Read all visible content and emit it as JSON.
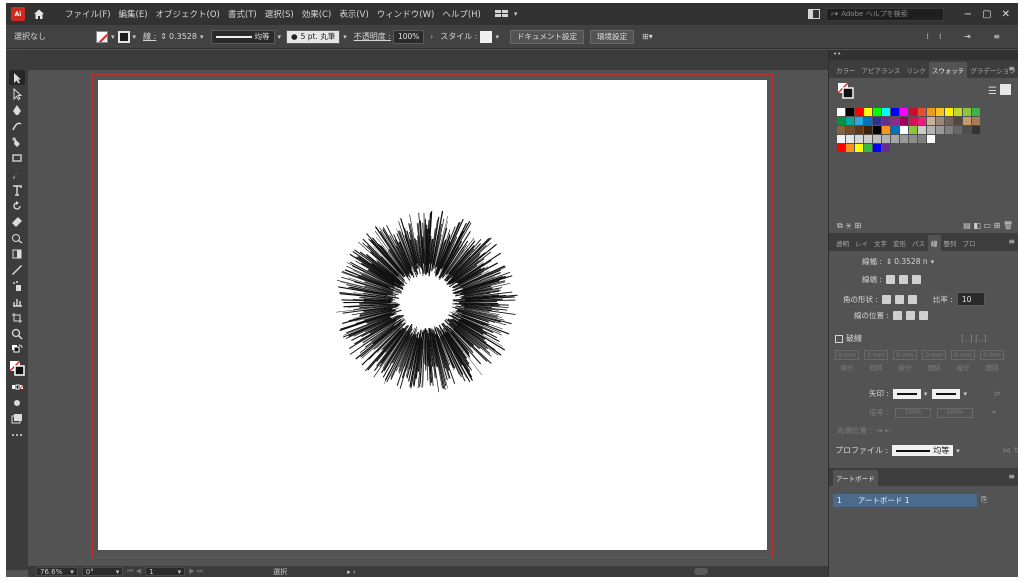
{
  "app": {
    "logo_text": "Ai",
    "menu": [
      "ファイル(F)",
      "編集(E)",
      "オブジェクト(O)",
      "書式(T)",
      "選択(S)",
      "効果(C)",
      "表示(V)",
      "ウィンドウ(W)",
      "ヘルプ(H)"
    ],
    "search_placeholder": "Adobe ヘルプを検索",
    "window_controls": [
      "−",
      "▢",
      "✕"
    ]
  },
  "controlbar": {
    "selection_status": "選択なし",
    "stroke_label": "線 :",
    "stroke_weight": "0.3528",
    "profile_label": "均等",
    "brush_label": "5 pt. 丸筆",
    "opacity_label": "不透明度 :",
    "opacity_value": "100%",
    "style_label": "スタイル :",
    "document_setup": "ドキュメント設定",
    "preferences": "環境設定"
  },
  "statusbar": {
    "zoom": "76.6%",
    "rotation": "0°",
    "artboard_number": "1",
    "tool_status": "選択"
  },
  "swatches_panel": {
    "tabs": [
      "カラー",
      "アピアランス",
      "リンク",
      "スウォッチ",
      "グラデーション"
    ],
    "active_tab": "スウォッチ",
    "rows": [
      [
        "#ffffff",
        "#000000",
        "#ff0000",
        "#ffff00",
        "#00ff00",
        "#00ffff",
        "#0000ff",
        "#ff00ff",
        "#c8102e",
        "#e05030",
        "#f29a1f",
        "#f7c520",
        "#fff200",
        "#c0d730",
        "#8cc63f",
        "#39b54a"
      ],
      [
        "#009444",
        "#00a99d",
        "#29abe2",
        "#0071bc",
        "#2e3192",
        "#662d91",
        "#92278f",
        "#9e005d",
        "#d4145a",
        "#ed1e79",
        "#c7b299",
        "#998675",
        "#736357",
        "#534741",
        "#c69c6d",
        "#a67c52"
      ],
      [
        "#8c6239",
        "#754c24",
        "#603813",
        "#42210b",
        "#000000",
        "#f7931e",
        "#0071bc",
        "#ffffff",
        "#8cc63f",
        "#cccccc",
        "#b3b3b3",
        "#999999",
        "#808080",
        "#666666",
        "#4d4d4d",
        "#333333"
      ],
      [
        "#f2f2f2",
        "#e6e6e6",
        "#d9d9d9",
        "#cccccc",
        "#bfbfbf",
        "#b3b3b3",
        "#a6a6a6",
        "#999999",
        "#8c8c8c",
        "#808080",
        "#ffffff"
      ],
      [
        "#ff0000",
        "#f7931e",
        "#ffff00",
        "#39b54a",
        "#0000ff",
        "#662d91"
      ]
    ]
  },
  "stroke_panel": {
    "tabs": [
      "透明",
      "レイ",
      "文字",
      "変形",
      "パス",
      "線",
      "整列",
      "プロ"
    ],
    "active_tab": "線",
    "weight_label": "線幅 :",
    "weight_value": "0.3528 n",
    "cap_label": "線端 :",
    "corner_label": "角の形状 :",
    "miter_label": "比率 :",
    "miter_value": "10",
    "align_label": "線の位置 :",
    "dashed_label": "破線",
    "dash_labels": [
      "線分",
      "間隔",
      "線分",
      "間隔",
      "線分",
      "間隔"
    ],
    "dash_values": [
      "0 mm",
      "0 mm",
      "0 mm",
      "0 mm",
      "0 mm",
      "0 mm"
    ],
    "arrow_label": "矢印 :",
    "scale_label": "倍率 :",
    "scale_values": [
      "100%",
      "100%"
    ],
    "arrow_align_label": "先端位置 :",
    "profile_label": "プロファイル :",
    "profile_value": "均等"
  },
  "artboards_panel": {
    "tab": "アートボード",
    "items": [
      {
        "number": "1",
        "name": "アートボード 1"
      }
    ]
  },
  "artwork": {
    "ray_color": "#111111",
    "ray_count": 420
  }
}
